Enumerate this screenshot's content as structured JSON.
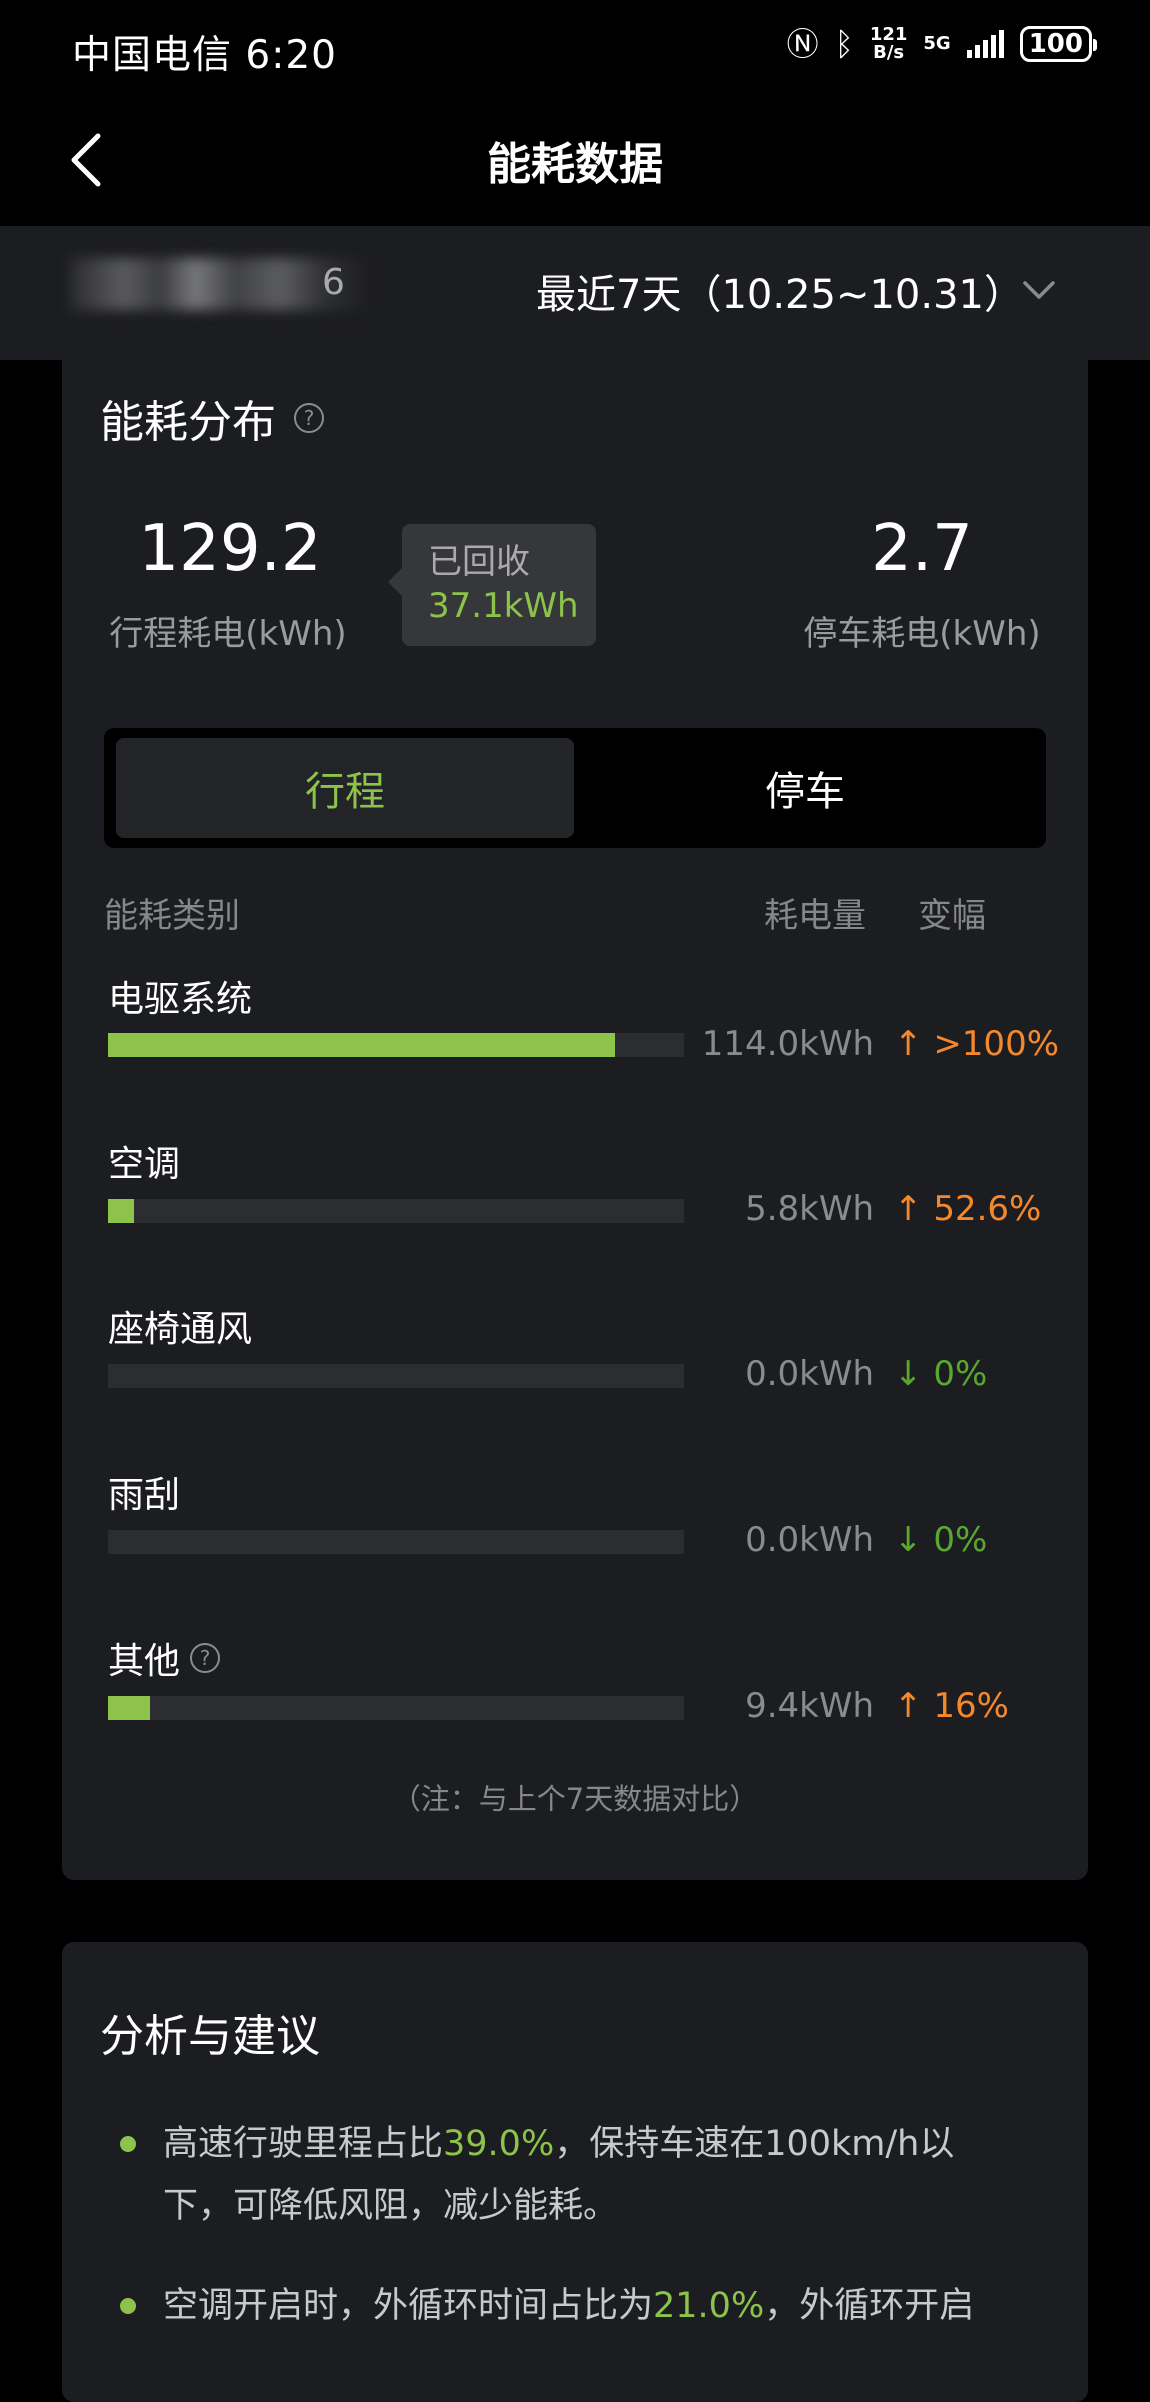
{
  "status_bar": {
    "carrier_time": "中国电信 6:20",
    "nfc_icon": "nfc-icon",
    "bluetooth_icon": "bluetooth-icon",
    "net_speed_value": "121",
    "net_speed_unit": "B/s",
    "network": "5G",
    "battery": "100"
  },
  "header": {
    "back_icon": "chevron-left-icon",
    "title": "能耗数据"
  },
  "vehicle_bar": {
    "vehicle_name_partial": "6",
    "date_range": "最近7天（10.25~10.31）",
    "dropdown_icon": "chevron-down-icon"
  },
  "energy_distribution": {
    "title": "能耗分布",
    "help_icon": "question-circle-icon",
    "driving_value": "129.2",
    "driving_label": "行程耗电(kWh)",
    "recovered_label": "已回收",
    "recovered_value": "37.1kWh",
    "parking_value": "2.7",
    "parking_label": "停车耗电(kWh)",
    "tabs": [
      {
        "label": "行程",
        "active": true
      },
      {
        "label": "停车",
        "active": false
      }
    ],
    "table_headers": {
      "category": "能耗类别",
      "consumption": "耗电量",
      "change": "变幅"
    },
    "categories": [
      {
        "label": "电驱系统",
        "value": "114.0kWh",
        "change": ">100%",
        "direction": "up",
        "arrow": "↑",
        "fill_fraction": 0.88
      },
      {
        "label": "空调",
        "value": "5.8kWh",
        "change": "52.6%",
        "direction": "up",
        "arrow": "↑",
        "fill_fraction": 0.045
      },
      {
        "label": "座椅通风",
        "value": "0.0kWh",
        "change": "0%",
        "direction": "down",
        "arrow": "↓",
        "fill_fraction": 0
      },
      {
        "label": "雨刮",
        "value": "0.0kWh",
        "change": "0%",
        "direction": "down",
        "arrow": "↓",
        "fill_fraction": 0
      },
      {
        "label": "其他",
        "value": "9.4kWh",
        "change": "16%",
        "direction": "up",
        "arrow": "↑",
        "fill_fraction": 0.073,
        "has_help": true
      }
    ],
    "note": "（注：与上个7天数据对比）"
  },
  "analysis": {
    "title": "分析与建议",
    "items": [
      {
        "pre": "高速行驶里程占比",
        "highlight": "39.0%",
        "post": "，保持车速在100km/h以下，可降低风阻，减少能耗。"
      },
      {
        "pre": "空调开启时，外循环时间占比为",
        "highlight": "21.0%",
        "post": "，外循环开启"
      }
    ]
  },
  "colors": {
    "background": "#000000",
    "card": "#1c1d21",
    "accent_green": "#8dc34a",
    "up_orange": "#f5882a",
    "down_green": "#5aa72f"
  }
}
